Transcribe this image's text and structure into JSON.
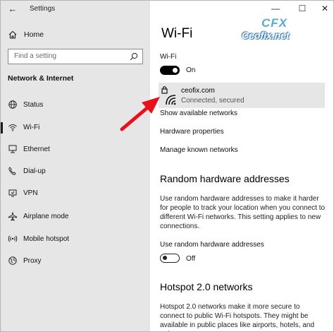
{
  "window": {
    "title": "Settings",
    "controls": {
      "minimize": "—",
      "maximize": "☐",
      "close": "✕"
    }
  },
  "sidebar": {
    "back": "←",
    "home_label": "Home",
    "search_placeholder": "Find a setting",
    "section_title": "Network & Internet",
    "items": [
      {
        "label": "Status",
        "icon": "status-globe-icon"
      },
      {
        "label": "Wi-Fi",
        "icon": "wifi-icon",
        "selected": true
      },
      {
        "label": "Ethernet",
        "icon": "ethernet-icon"
      },
      {
        "label": "Dial-up",
        "icon": "dialup-icon"
      },
      {
        "label": "VPN",
        "icon": "vpn-icon"
      },
      {
        "label": "Airplane mode",
        "icon": "airplane-icon"
      },
      {
        "label": "Mobile hotspot",
        "icon": "hotspot-icon"
      },
      {
        "label": "Proxy",
        "icon": "globe-icon"
      }
    ]
  },
  "main": {
    "title": "Wi-Fi",
    "wifi_label": "Wi-Fi",
    "wifi_state": "On",
    "network": {
      "name": "ceofix.com",
      "status": "Connected, secured"
    },
    "links": [
      "Show available networks",
      "Hardware properties",
      "Manage known networks"
    ],
    "random_hw": {
      "heading": "Random hardware addresses",
      "description": "Use random hardware addresses to make it harder for people to track your location when you connect to different Wi-Fi networks. This setting applies to new connections.",
      "toggle_label": "Use random hardware addresses",
      "toggle_state": "Off"
    },
    "hotspot": {
      "heading": "Hotspot 2.0 networks",
      "description": "Hotspot 2.0 networks make it more secure to connect to public Wi-Fi hotspots. They might be available in public places like airports, hotels, and cafes."
    }
  },
  "watermark": {
    "logo": "CFX",
    "site": "Ceofix.net"
  },
  "colors": {
    "sidebar_bg": "#e6e6e6",
    "accent_arrow": "#e8101a",
    "logo_blue": "#5aa9d6"
  }
}
